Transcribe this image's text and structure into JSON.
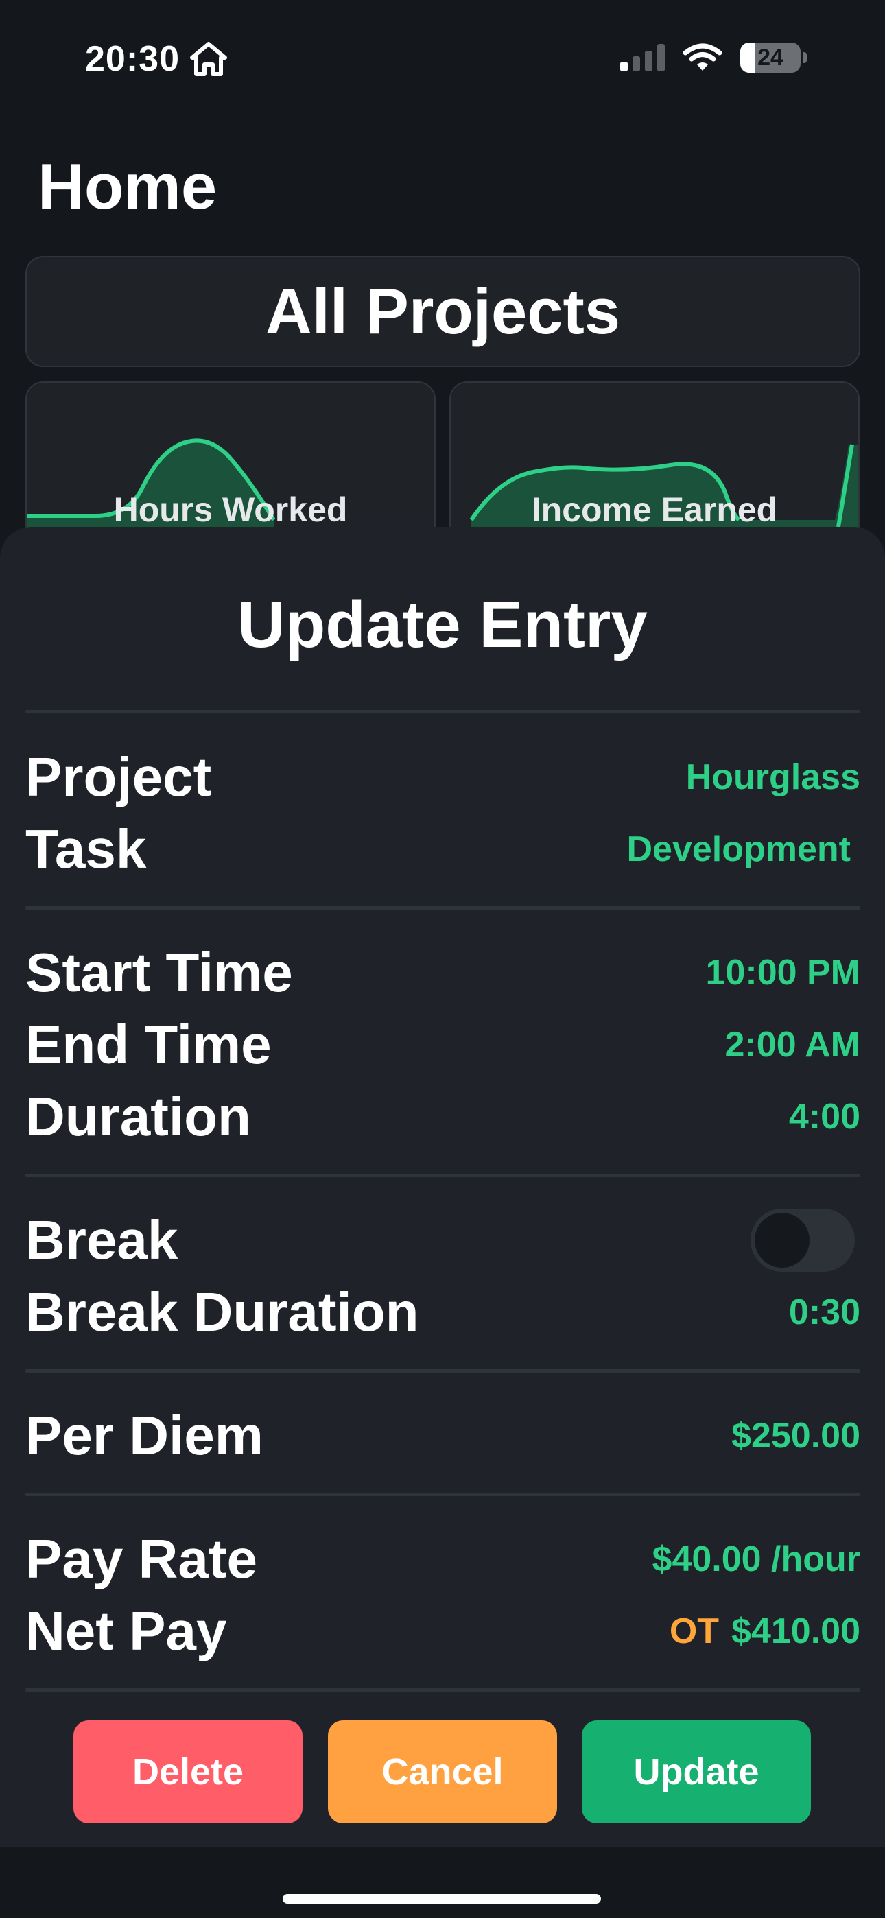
{
  "status_bar": {
    "time": "20:30",
    "battery_percent": "24",
    "signal_bars_active": 1,
    "icons": [
      "home-icon",
      "cellular-signal-icon",
      "wifi-icon",
      "battery-icon"
    ]
  },
  "home": {
    "title": "Home",
    "projects_selector": "All Projects",
    "cards": [
      {
        "label": "Hours Worked"
      },
      {
        "label": "Income Earned"
      }
    ]
  },
  "sheet": {
    "title": "Update Entry",
    "project": {
      "label": "Project",
      "value": "Hourglass"
    },
    "task": {
      "label": "Task",
      "value": "Development"
    },
    "start_time": {
      "label": "Start Time",
      "value": "10:00 PM"
    },
    "end_time": {
      "label": "End Time",
      "value": "2:00 AM"
    },
    "duration": {
      "label": "Duration",
      "value": "4:00"
    },
    "break": {
      "label": "Break",
      "enabled": false
    },
    "break_duration": {
      "label": "Break Duration",
      "value": "0:30"
    },
    "per_diem": {
      "label": "Per Diem",
      "value": "$250.00"
    },
    "pay_rate": {
      "label": "Pay Rate",
      "value": "$40.00 /hour"
    },
    "net_pay": {
      "label": "Net Pay",
      "ot_badge": "OT",
      "value": "$410.00"
    }
  },
  "actions": {
    "delete": "Delete",
    "cancel": "Cancel",
    "update": "Update"
  },
  "colors": {
    "accent_green": "#2ecf86",
    "overtime_orange": "#ffa53a",
    "delete_red": "#ff5d68",
    "cancel_orange": "#ffa140",
    "update_green": "#16b070",
    "background": "#14171b",
    "sheet": "#1f2329"
  }
}
